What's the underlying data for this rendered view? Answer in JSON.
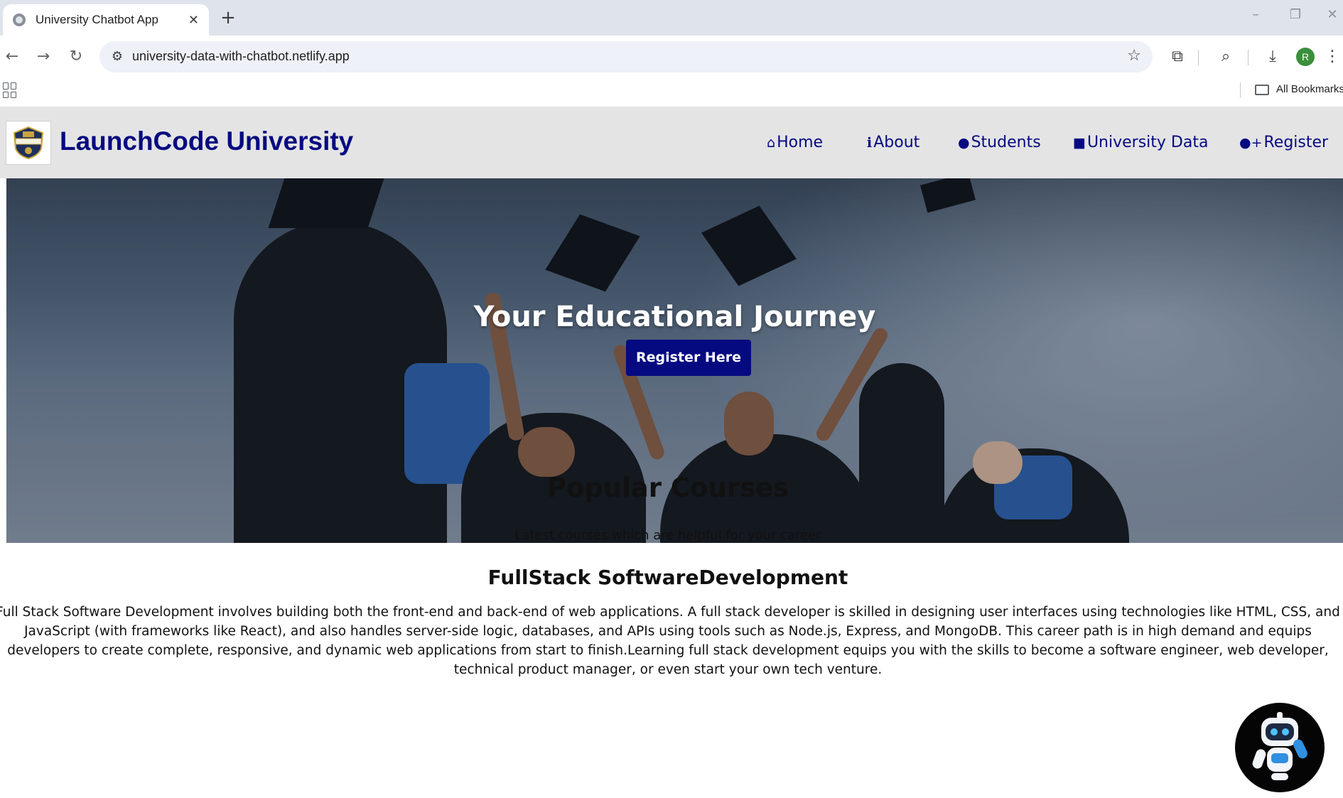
{
  "browser": {
    "tab_title": "University Chatbot App",
    "tab_close": "✕",
    "new_tab": "+",
    "url": "university-data-with-chatbot.netlify.app",
    "profile_initial": "R",
    "bookmarks_label": "All Bookmarks"
  },
  "site": {
    "brand": "LaunchCode University",
    "nav": [
      {
        "label": "Home",
        "icon": "home-icon"
      },
      {
        "label": "About",
        "icon": "info-icon"
      },
      {
        "label": "Students",
        "icon": "user-icon"
      },
      {
        "label": "University Data",
        "icon": "briefcase-icon"
      },
      {
        "label": "Register",
        "icon": "user-plus-icon"
      }
    ],
    "hero": {
      "title": "Your Educational Journey",
      "button": "Register Here"
    },
    "courses": {
      "title": "Popular Courses",
      "subtitle": "Latest courses which are helpful for your career",
      "course_name": "FullStack SoftwareDevelopment",
      "course_description": "Full Stack Software Development involves building both the front-end and back-end of web applications. A full stack developer is skilled in designing user interfaces using technologies like HTML, CSS, and JavaScript (with frameworks like React), and also handles server-side logic, databases, and APIs using tools such as Node.js, Express, and MongoDB. This career path is in high demand and equips developers to create complete, responsive, and dynamic web applications from start to finish.Learning full stack development equips you with the skills to become a software engineer, web developer, technical product manager, or even start your own tech venture."
    }
  },
  "colors": {
    "brand": "#050a80",
    "nav_bg": "#e4e4e4",
    "button_text": "#ffffff"
  }
}
